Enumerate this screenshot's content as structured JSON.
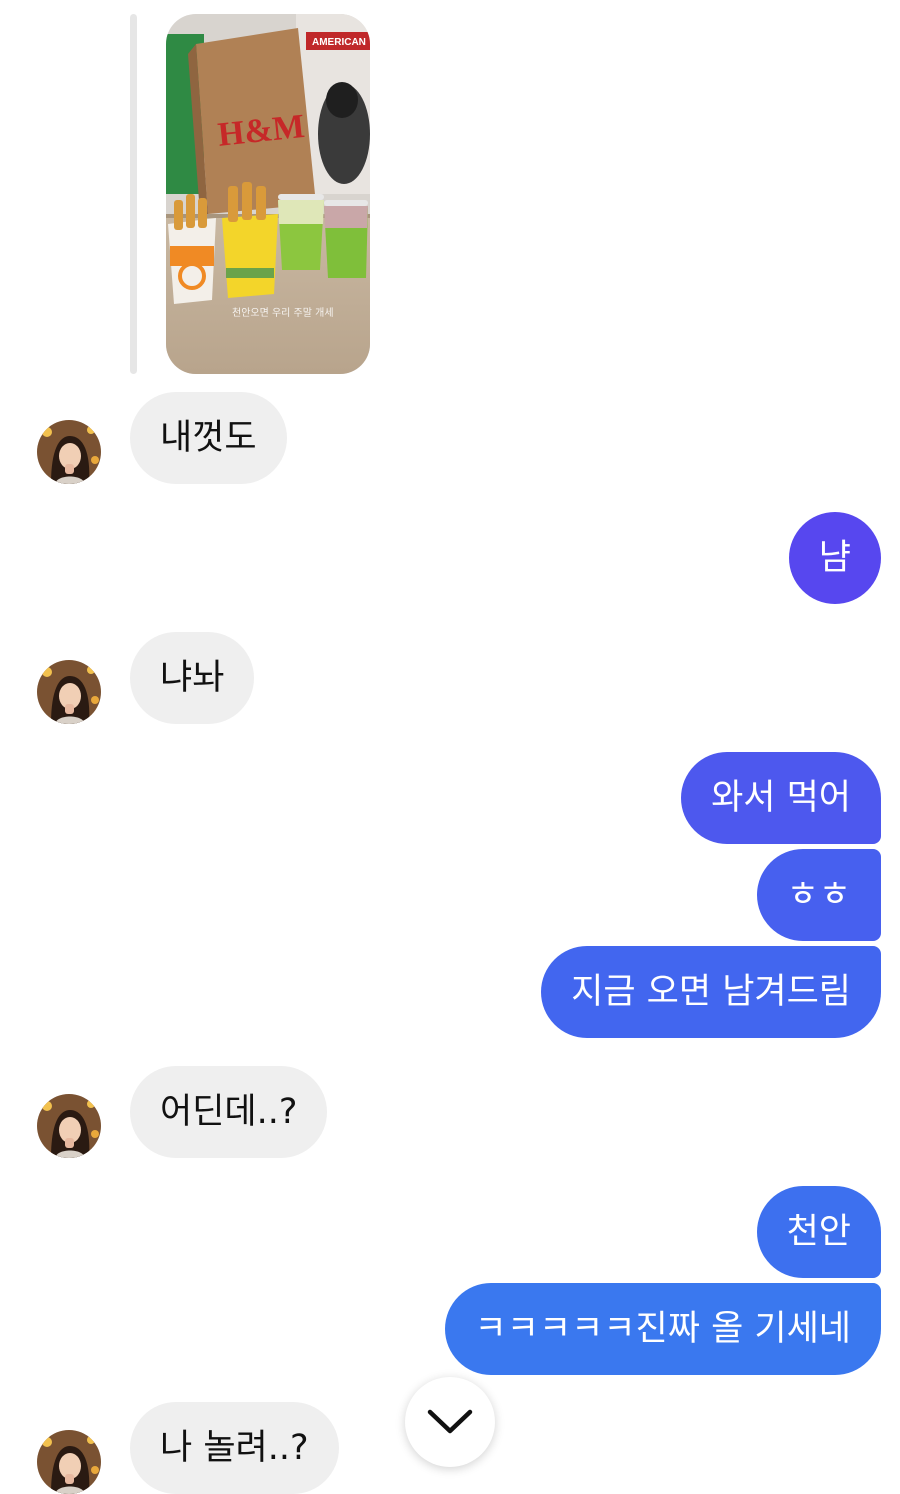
{
  "thread": {
    "story_reply": {
      "image": "story-photo-pretzel-cups-and-hm-bag",
      "bag_text": "H&M",
      "sign_text": "AMERICAN",
      "caption": "천안오면 우리 주말 개세"
    },
    "messages": [
      {
        "from": "them",
        "text": "내껏도"
      },
      {
        "from": "me",
        "text": "냠"
      },
      {
        "from": "them",
        "text": "냐놔"
      },
      {
        "from": "me",
        "text": "와서 먹어"
      },
      {
        "from": "me",
        "text": "ㅎㅎ"
      },
      {
        "from": "me",
        "text": "지금 오면 남겨드림"
      },
      {
        "from": "them",
        "text": "어딘데..?"
      },
      {
        "from": "me",
        "text": "천안"
      },
      {
        "from": "me",
        "text": "ㅋㅋㅋㅋㅋ진짜 올 기세네"
      },
      {
        "from": "them",
        "text": "나 놀려..?"
      }
    ]
  },
  "controls": {
    "scroll_down_icon": "chevron-down-icon"
  },
  "colors": {
    "incoming_bubble": "#efefef",
    "outgoing_gradient": [
      "#5b4cf0",
      "#3a7cf0"
    ],
    "background": "#ffffff"
  }
}
